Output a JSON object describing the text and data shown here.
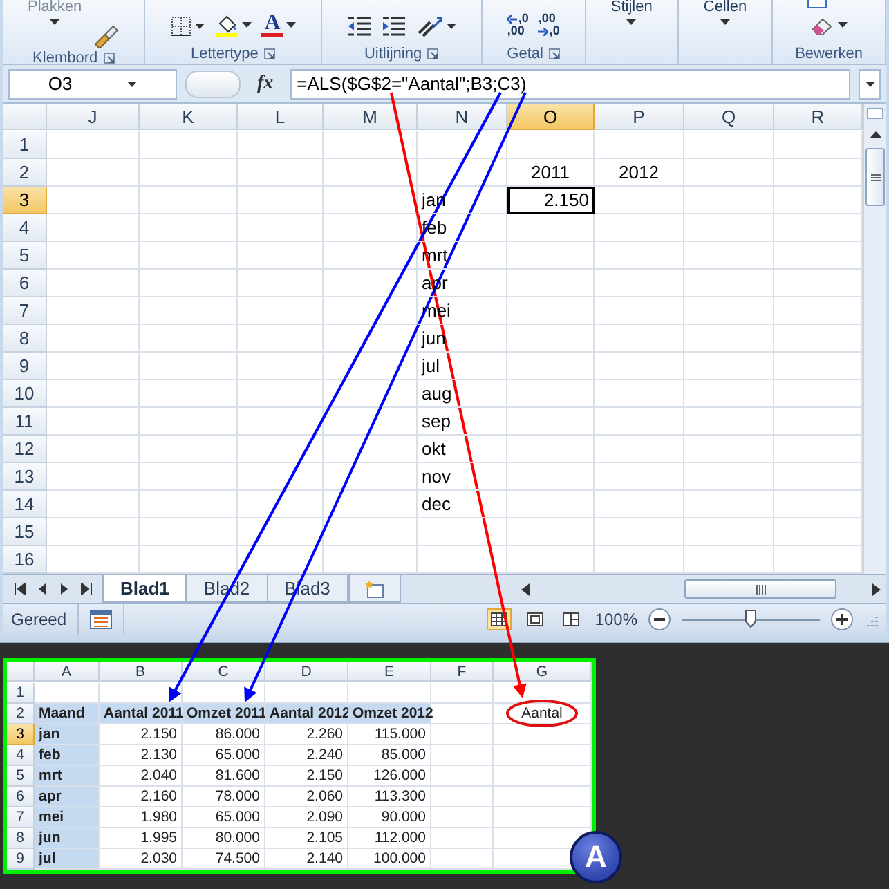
{
  "ribbon": {
    "groups": [
      {
        "label": "Klembord",
        "launcher": true,
        "items": [
          {
            "kind": "paste",
            "text": "Plakken",
            "disabled": true
          },
          {
            "kind": "format-painter"
          }
        ]
      },
      {
        "label": "Lettertype",
        "launcher": true,
        "items": [
          {
            "kind": "borders"
          },
          {
            "kind": "fill-color"
          },
          {
            "kind": "font-color",
            "text": "A"
          }
        ]
      },
      {
        "label": "Uitlijning",
        "launcher": true,
        "items": [
          {
            "kind": "outdent"
          },
          {
            "kind": "indent"
          },
          {
            "kind": "orientation"
          }
        ]
      },
      {
        "label": "Getal",
        "launcher": true,
        "items": [
          {
            "kind": "decimal-more",
            "lines": [
              ",0",
              ",00"
            ]
          },
          {
            "kind": "decimal-less",
            "lines": [
              ",00",
              ",0"
            ]
          }
        ]
      },
      {
        "launcher": false,
        "items": [
          {
            "kind": "menu",
            "text": "Stijlen"
          }
        ]
      },
      {
        "launcher": false,
        "items": [
          {
            "kind": "menu",
            "text": "Cellen"
          }
        ]
      },
      {
        "label": "Bewerken",
        "launcher": false,
        "items": [
          {
            "kind": "clear"
          }
        ]
      }
    ]
  },
  "formula_bar": {
    "name_box": "O3",
    "fx": "fx",
    "formula": "=ALS($G$2=\"Aantal\";B3;C3)"
  },
  "sheet": {
    "columns": [
      {
        "label": "J",
        "selected": false
      },
      {
        "label": "K",
        "selected": false
      },
      {
        "label": "L",
        "selected": false
      },
      {
        "label": "M",
        "selected": false
      },
      {
        "label": "N",
        "selected": false
      },
      {
        "label": "O",
        "selected": true
      },
      {
        "label": "P",
        "selected": false
      },
      {
        "label": "Q",
        "selected": false
      },
      {
        "label": "R",
        "selected": false
      }
    ],
    "rows": [
      {
        "header": "1",
        "selected": false,
        "cells": [
          {},
          {},
          {},
          {},
          {},
          {},
          {},
          {},
          {}
        ]
      },
      {
        "header": "2",
        "selected": false,
        "cells": [
          {},
          {},
          {},
          {},
          {},
          {
            "text": "2011",
            "kind": "title"
          },
          {
            "text": "2012",
            "kind": "title"
          },
          {},
          {}
        ]
      },
      {
        "header": "3",
        "selected": true,
        "cells": [
          {},
          {},
          {},
          {},
          {
            "text": "jan",
            "kind": "label"
          },
          {
            "text": "2.150",
            "kind": "number"
          },
          {},
          {},
          {}
        ]
      },
      {
        "header": "4",
        "selected": false,
        "cells": [
          {},
          {},
          {},
          {},
          {
            "text": "feb",
            "kind": "label"
          },
          {},
          {},
          {},
          {}
        ]
      },
      {
        "header": "5",
        "selected": false,
        "cells": [
          {},
          {},
          {},
          {},
          {
            "text": "mrt",
            "kind": "label"
          },
          {},
          {},
          {},
          {}
        ]
      },
      {
        "header": "6",
        "selected": false,
        "cells": [
          {},
          {},
          {},
          {},
          {
            "text": "apr",
            "kind": "label"
          },
          {},
          {},
          {},
          {}
        ]
      },
      {
        "header": "7",
        "selected": false,
        "cells": [
          {},
          {},
          {},
          {},
          {
            "text": "mei",
            "kind": "label"
          },
          {},
          {},
          {},
          {}
        ]
      },
      {
        "header": "8",
        "selected": false,
        "cells": [
          {},
          {},
          {},
          {},
          {
            "text": "jun",
            "kind": "label"
          },
          {},
          {},
          {},
          {}
        ]
      },
      {
        "header": "9",
        "selected": false,
        "cells": [
          {},
          {},
          {},
          {},
          {
            "text": "jul",
            "kind": "label"
          },
          {},
          {},
          {},
          {}
        ]
      },
      {
        "header": "10",
        "selected": false,
        "cells": [
          {},
          {},
          {},
          {},
          {
            "text": "aug",
            "kind": "label"
          },
          {},
          {},
          {},
          {}
        ]
      },
      {
        "header": "11",
        "selected": false,
        "cells": [
          {},
          {},
          {},
          {},
          {
            "text": "sep",
            "kind": "label"
          },
          {},
          {},
          {},
          {}
        ]
      },
      {
        "header": "12",
        "selected": false,
        "cells": [
          {},
          {},
          {},
          {},
          {
            "text": "okt",
            "kind": "label"
          },
          {},
          {},
          {},
          {}
        ]
      },
      {
        "header": "13",
        "selected": false,
        "cells": [
          {},
          {},
          {},
          {},
          {
            "text": "nov",
            "kind": "label"
          },
          {},
          {},
          {},
          {}
        ]
      },
      {
        "header": "14",
        "selected": false,
        "cells": [
          {},
          {},
          {},
          {},
          {
            "text": "dec",
            "kind": "label"
          },
          {},
          {},
          {},
          {}
        ]
      },
      {
        "header": "15",
        "selected": false,
        "cells": [
          {},
          {},
          {},
          {},
          {},
          {},
          {},
          {},
          {}
        ]
      },
      {
        "header": "16",
        "selected": false,
        "cells": [
          {},
          {},
          {},
          {},
          {},
          {},
          {},
          {},
          {}
        ]
      }
    ]
  },
  "sheet_tabs": [
    {
      "label": "Blad1",
      "selected": true
    },
    {
      "label": "Blad2",
      "selected": false
    },
    {
      "label": "Blad3",
      "selected": false
    }
  ],
  "status_bar": {
    "text": "Gereed",
    "views": [
      {
        "kind": "normal",
        "selected": true
      },
      {
        "kind": "page-layout",
        "selected": false
      },
      {
        "kind": "page-break",
        "selected": false
      }
    ],
    "zoom": "100%",
    "zoom_slider": {
      "level": 0.5
    }
  },
  "inset": {
    "columns": [
      {
        "label": "A",
        "selected": false
      },
      {
        "label": "B",
        "selected": false
      },
      {
        "label": "C",
        "selected": false
      },
      {
        "label": "D",
        "selected": false
      },
      {
        "label": "E",
        "selected": false
      },
      {
        "label": "F",
        "selected": false
      },
      {
        "label": "G",
        "selected": false
      }
    ],
    "rows": [
      {
        "header": "1",
        "selected": false,
        "cells": [
          {},
          {},
          {},
          {},
          {},
          {},
          {}
        ]
      },
      {
        "header": "2",
        "selected": false,
        "cells": [
          {
            "text": "Maand",
            "kind": "heading"
          },
          {
            "text": "Aantal 2011",
            "kind": "heading"
          },
          {
            "text": "Omzet 2011",
            "kind": "heading"
          },
          {
            "text": "Aantal 2012",
            "kind": "heading"
          },
          {
            "text": "Omzet 2012",
            "kind": "heading"
          },
          {},
          {
            "text": "Aantal",
            "kind": "circled"
          }
        ]
      },
      {
        "header": "3",
        "selected": true,
        "cells": [
          {
            "text": "jan",
            "kind": "heading"
          },
          {
            "text": "2.150",
            "kind": "number"
          },
          {
            "text": "86.000",
            "kind": "number"
          },
          {
            "text": "2.260",
            "kind": "number"
          },
          {
            "text": "115.000",
            "kind": "number"
          },
          {},
          {}
        ]
      },
      {
        "header": "4",
        "selected": false,
        "cells": [
          {
            "text": "feb",
            "kind": "heading"
          },
          {
            "text": "2.130",
            "kind": "number"
          },
          {
            "text": "65.000",
            "kind": "number"
          },
          {
            "text": "2.240",
            "kind": "number"
          },
          {
            "text": "85.000",
            "kind": "number"
          },
          {},
          {}
        ]
      },
      {
        "header": "5",
        "selected": false,
        "cells": [
          {
            "text": "mrt",
            "kind": "heading"
          },
          {
            "text": "2.040",
            "kind": "number"
          },
          {
            "text": "81.600",
            "kind": "number"
          },
          {
            "text": "2.150",
            "kind": "number"
          },
          {
            "text": "126.000",
            "kind": "number"
          },
          {},
          {}
        ]
      },
      {
        "header": "6",
        "selected": false,
        "cells": [
          {
            "text": "apr",
            "kind": "heading"
          },
          {
            "text": "2.160",
            "kind": "number"
          },
          {
            "text": "78.000",
            "kind": "number"
          },
          {
            "text": "2.060",
            "kind": "number"
          },
          {
            "text": "113.300",
            "kind": "number"
          },
          {},
          {}
        ]
      },
      {
        "header": "7",
        "selected": false,
        "cells": [
          {
            "text": "mei",
            "kind": "heading"
          },
          {
            "text": "1.980",
            "kind": "number"
          },
          {
            "text": "65.000",
            "kind": "number"
          },
          {
            "text": "2.090",
            "kind": "number"
          },
          {
            "text": "90.000",
            "kind": "number"
          },
          {},
          {}
        ]
      },
      {
        "header": "8",
        "selected": false,
        "cells": [
          {
            "text": "jun",
            "kind": "heading"
          },
          {
            "text": "1.995",
            "kind": "number"
          },
          {
            "text": "80.000",
            "kind": "number"
          },
          {
            "text": "2.105",
            "kind": "number"
          },
          {
            "text": "112.000",
            "kind": "number"
          },
          {},
          {}
        ]
      },
      {
        "header": "9",
        "selected": false,
        "cells": [
          {
            "text": "jul",
            "kind": "heading"
          },
          {
            "text": "2.030",
            "kind": "number"
          },
          {
            "text": "74.500",
            "kind": "number"
          },
          {
            "text": "2.140",
            "kind": "number"
          },
          {
            "text": "100.000",
            "kind": "number"
          },
          {},
          {}
        ]
      }
    ],
    "badge": "A"
  }
}
